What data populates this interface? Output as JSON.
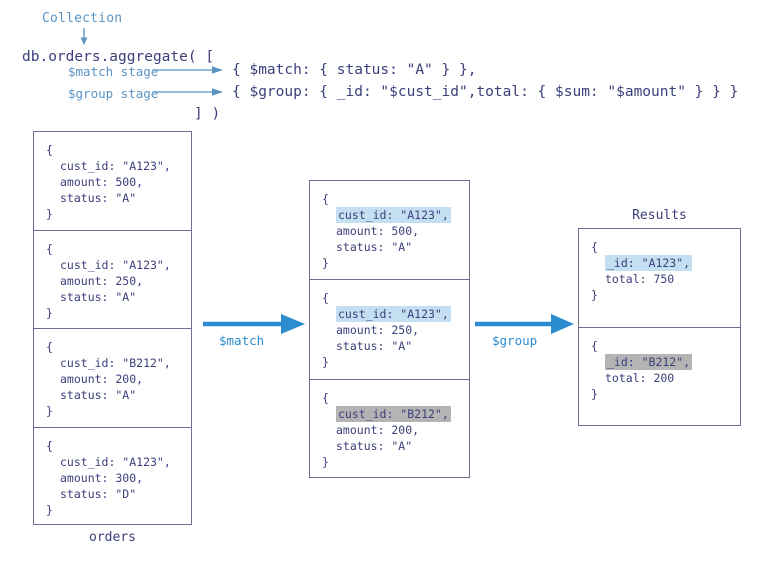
{
  "header": {
    "collection_label": "Collection",
    "code": {
      "call_line": "db.orders.aggregate( [",
      "match_line": "{ $match: { status: \"A\" } },",
      "group_line": "{ $group: { _id: \"$cust_id\",total: { $sum: \"$amount\" } } }",
      "close_line": "] )"
    },
    "stage_labels": {
      "match": "$match stage",
      "group": "$group stage"
    }
  },
  "pipeline": {
    "arrow_match_label": "$match",
    "arrow_group_label": "$group"
  },
  "colors": {
    "accent_blue": "#2b8cd0",
    "label_blue": "#5a93c4",
    "text_navy": "#3b3f7a",
    "box_border": "#6b6e92",
    "highlight_blue": "#c5dff2",
    "highlight_gray": "#b4b4b4"
  },
  "orders": {
    "caption": "orders",
    "docs": [
      {
        "open": "{",
        "l1": "cust_id: \"A123\",",
        "l2": "amount: 500,",
        "l3": "status: \"A\"",
        "close": "}",
        "highlight": "none"
      },
      {
        "open": "{",
        "l1": "cust_id: \"A123\",",
        "l2": "amount: 250,",
        "l3": "status: \"A\"",
        "close": "}",
        "highlight": "none"
      },
      {
        "open": "{",
        "l1": "cust_id: \"B212\",",
        "l2": "amount: 200,",
        "l3": "status: \"A\"",
        "close": "}",
        "highlight": "none"
      },
      {
        "open": "{",
        "l1": "cust_id: \"A123\",",
        "l2": "amount: 300,",
        "l3": "status: \"D\"",
        "close": "}",
        "highlight": "none"
      }
    ]
  },
  "matched": {
    "docs": [
      {
        "open": "{",
        "l1": "cust_id: \"A123\",",
        "l2": "amount: 500,",
        "l3": "status: \"A\"",
        "close": "}",
        "highlight": "blue"
      },
      {
        "open": "{",
        "l1": "cust_id: \"A123\",",
        "l2": "amount: 250,",
        "l3": "status: \"A\"",
        "close": "}",
        "highlight": "blue"
      },
      {
        "open": "{",
        "l1": "cust_id: \"B212\",",
        "l2": "amount: 200,",
        "l3": "status: \"A\"",
        "close": "}",
        "highlight": "gray"
      }
    ]
  },
  "results": {
    "caption": "Results",
    "docs": [
      {
        "open": "{",
        "l1": "_id: \"A123\",",
        "l2": "total: 750",
        "close": "}",
        "highlight": "blue"
      },
      {
        "open": "{",
        "l1": "_id: \"B212\",",
        "l2": "total: 200",
        "close": "}",
        "highlight": "gray"
      }
    ]
  }
}
